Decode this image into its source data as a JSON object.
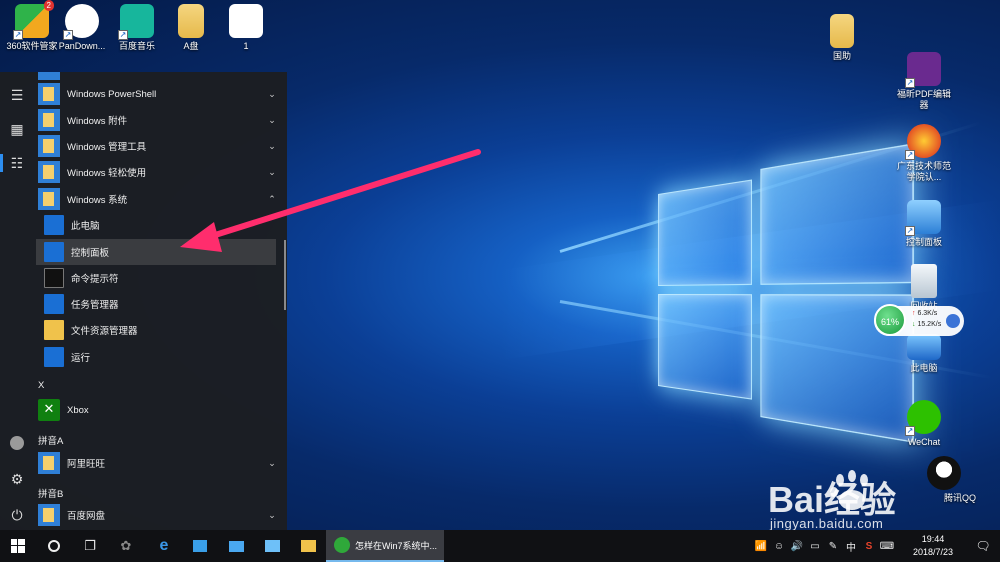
{
  "desktop": {
    "icons_left": [
      {
        "label": "360软件管家",
        "icon": "360-software-manager-icon",
        "badge": "2"
      },
      {
        "label": "PanDown...",
        "icon": "pandownload-cloud-icon"
      },
      {
        "label": "百度音乐",
        "icon": "baidu-music-icon"
      },
      {
        "label": "A盘",
        "icon": "folder-icon"
      },
      {
        "label": "1",
        "icon": "document-icon"
      }
    ],
    "icons_right": [
      {
        "label": "国助",
        "icon": "folder-icon"
      },
      {
        "label": "福昕PDF编辑器",
        "icon": "foxit-pdf-icon"
      },
      {
        "label": "广东技术师范学院认...",
        "icon": "browser-icon"
      },
      {
        "label": "控制面板",
        "icon": "control-panel-icon"
      },
      {
        "label": "回收站",
        "icon": "recycle-bin-icon"
      },
      {
        "label": "此电脑",
        "icon": "this-pc-icon"
      },
      {
        "label": "WeChat",
        "icon": "wechat-icon"
      },
      {
        "label": "腾讯QQ",
        "icon": "qq-icon"
      }
    ]
  },
  "start_menu": {
    "rail": [
      "hamburger-menu-icon",
      "tiles-icon",
      "list-icon",
      "user-icon",
      "settings-icon",
      "power-icon"
    ],
    "items": [
      {
        "type": "folder",
        "label": "Windows PowerShell",
        "chevron": "down"
      },
      {
        "type": "folder",
        "label": "Windows 附件",
        "chevron": "down"
      },
      {
        "type": "folder",
        "label": "Windows 管理工具",
        "chevron": "down"
      },
      {
        "type": "folder",
        "label": "Windows 轻松使用",
        "chevron": "down"
      },
      {
        "type": "folder",
        "label": "Windows 系统",
        "chevron": "up"
      },
      {
        "type": "app",
        "label": "此电脑"
      },
      {
        "type": "app",
        "label": "控制面板",
        "selected": true
      },
      {
        "type": "app",
        "label": "命令提示符"
      },
      {
        "type": "app",
        "label": "任务管理器"
      },
      {
        "type": "app",
        "label": "文件资源管理器"
      },
      {
        "type": "app",
        "label": "运行"
      },
      {
        "type": "letter",
        "label": "X"
      },
      {
        "type": "xbox",
        "label": "Xbox"
      },
      {
        "type": "letter",
        "label": "拼音A"
      },
      {
        "type": "folder",
        "label": "阿里旺旺",
        "chevron": "down"
      },
      {
        "type": "letter",
        "label": "拼音B"
      },
      {
        "type": "folder",
        "label": "百度网盘",
        "chevron": "down"
      }
    ]
  },
  "net_widget": {
    "percent": "61%",
    "upload": "6.3K/s",
    "download": "15.2K/s"
  },
  "watermark": {
    "logo": "Bai经验",
    "url": "jingyan.baidu.com"
  },
  "taskbar": {
    "task_label": "怎样在Win7系统中...",
    "ime": "中",
    "time": "19:44",
    "date": "2018/7/23"
  },
  "colors": {
    "accent": "#2d8ef0",
    "annotation_arrow": "#ff2d6d",
    "taskbar": "#101114"
  }
}
